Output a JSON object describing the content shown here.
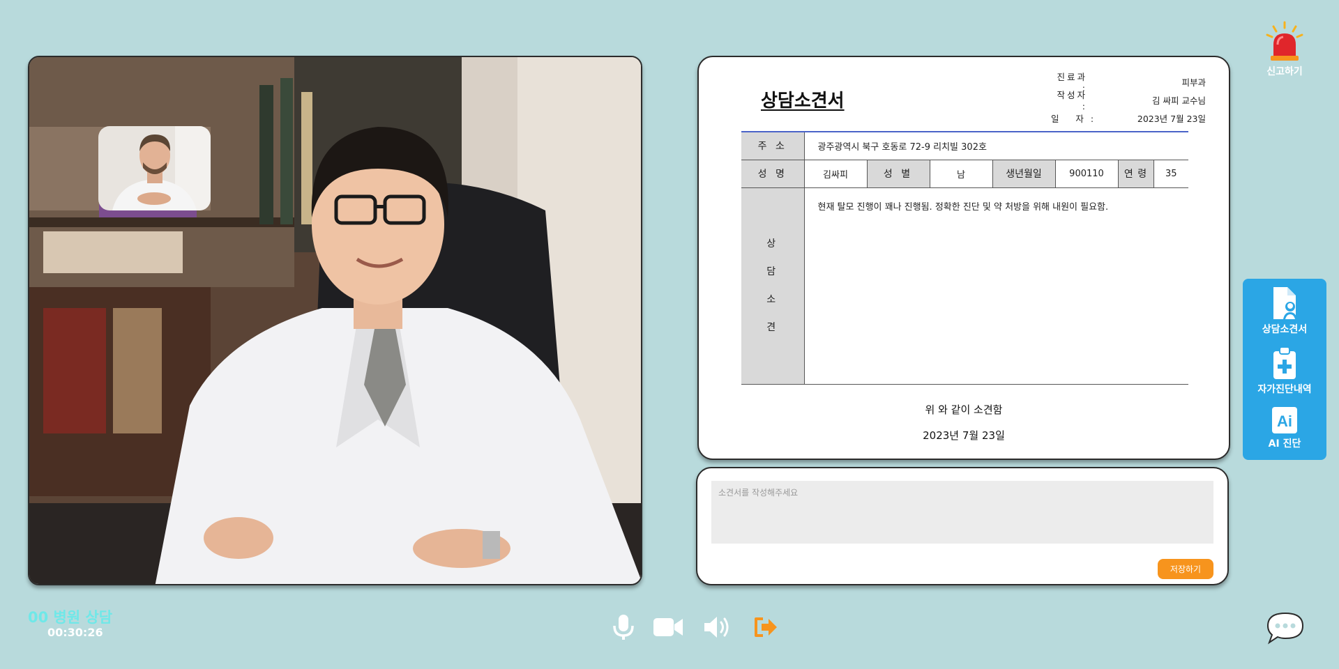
{
  "call": {
    "hospital_label": "00 병원 상담",
    "elapsed": "00:30:26"
  },
  "report": {
    "label": "신고하기"
  },
  "document": {
    "title": "상담소견서",
    "meta": [
      {
        "key": "진료과 :",
        "value": "피부과"
      },
      {
        "key": "작성자 :",
        "value": "김 싸피 교수님"
      },
      {
        "key": "일   자 :",
        "value": "2023년 7월 23일"
      }
    ],
    "address_label": "주 소",
    "address_value": "광주광역시 북구 호동로 72-9 리치빌 302호",
    "name_label": "성 명",
    "name_value": "김싸피",
    "gender_label": "성 별",
    "gender_value": "남",
    "birth_label": "생년월일",
    "birth_value": "900110",
    "age_label": "연 령",
    "age_value": "35",
    "opinion_label": [
      "상",
      "담",
      "소",
      "견"
    ],
    "opinion_text": "현재 탈모 진행이 꽤나 진행됨. 정확한 진단 및 약 처방을 위해 내원이 필요함.",
    "conclusion": "위 와 같이 소견함",
    "conclusion_date": "2023년 7월 23일"
  },
  "editor": {
    "placeholder": "소견서를 작성해주세요",
    "save_label": "저장하기"
  },
  "side_menu": [
    {
      "label": "상담소견서",
      "icon": "document-user-icon"
    },
    {
      "label": "자가진단내역",
      "icon": "clipboard-plus-icon"
    },
    {
      "label": "AI 진단",
      "icon": "ai-icon"
    }
  ],
  "controls": {
    "mic_icon": "microphone-icon",
    "camera_icon": "video-camera-icon",
    "speaker_icon": "speaker-icon",
    "leave_icon": "leave-icon",
    "chat_icon": "chat-bubble-icon"
  },
  "colors": {
    "background": "#b8dadc",
    "accent_orange": "#f7941d",
    "side_panel": "#2ba6e5",
    "hospital_label": "#6fe8e8",
    "alarm_red": "#e0262b"
  }
}
